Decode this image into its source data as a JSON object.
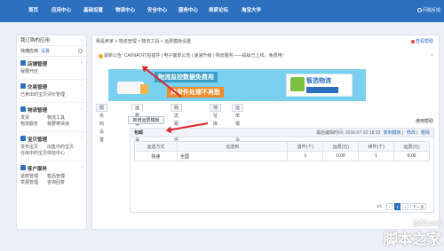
{
  "nav": {
    "items": [
      "首页",
      "应用中心",
      "基础设置",
      "物流中心",
      "安全中心",
      "服务中心",
      "卖家论坛",
      "淘宝大学"
    ],
    "help": "问题反馈"
  },
  "sidebar": {
    "title": "我订购的应用",
    "quick": "快捷应用",
    "quick_settings": "设置",
    "groups": [
      {
        "title": "店铺管理",
        "links": [
          "我要开店"
        ]
      },
      {
        "title": "交易管理",
        "links": [
          "已卖出的宝贝",
          "评价管理"
        ]
      },
      {
        "title": "物流管理",
        "links": [
          "发货",
          "物流工具",
          "物流服务",
          "我要寄快递"
        ]
      },
      {
        "title": "宝贝管理",
        "links": [
          "发布宝贝",
          "出售中的宝贝",
          "仓库中的宝贝",
          "体检中心"
        ]
      },
      {
        "title": "客户服务",
        "links": [
          "退款管理",
          "售后管理",
          "举报管理",
          "咨询回复"
        ]
      }
    ]
  },
  "main": {
    "breadcrumb": "我是卖家 > 物流管理 > 物流工具 > 运费模板设置",
    "view_tip": "查看帮助",
    "notice": "最新公告: CAINIAO打包插件 | 电子面单公告 | 速递升级 | 物流服务——蚂蚁已上线，免费用！",
    "banner": {
      "line1": "物流监控数据免费用",
      "line2": "异常件处理不再愁",
      "logo": "智选物流"
    },
    "tabs": [
      "服务商设置",
      "运费模板设置",
      "物流跟踪信息",
      "地址库",
      "运单模板设置"
    ],
    "active_tab": 1,
    "add_button": "新增运费模板",
    "use_help": "使用帮助",
    "template": {
      "name": "包邮",
      "updated": "最后编辑时间: 2016-07-22 18:33",
      "actions": [
        "复制模板",
        "修改",
        "删除"
      ],
      "columns": [
        "运送方式",
        "运送到",
        "首件(个)",
        "运费(元)",
        "续件(个)",
        "运费(元)"
      ],
      "rows": [
        [
          "快递",
          "全国",
          "1",
          "0.00",
          "1",
          "0.00"
        ]
      ]
    },
    "pager": {
      "count": "1/1",
      "current": "1",
      "next": "下一页"
    }
  },
  "watermark": {
    "site": "jb51.net",
    "brand": "脚本之家"
  },
  "colors": {
    "nav": "#2c6fbf",
    "arrow": "#e3232b",
    "banner": "#7ad0ef"
  }
}
